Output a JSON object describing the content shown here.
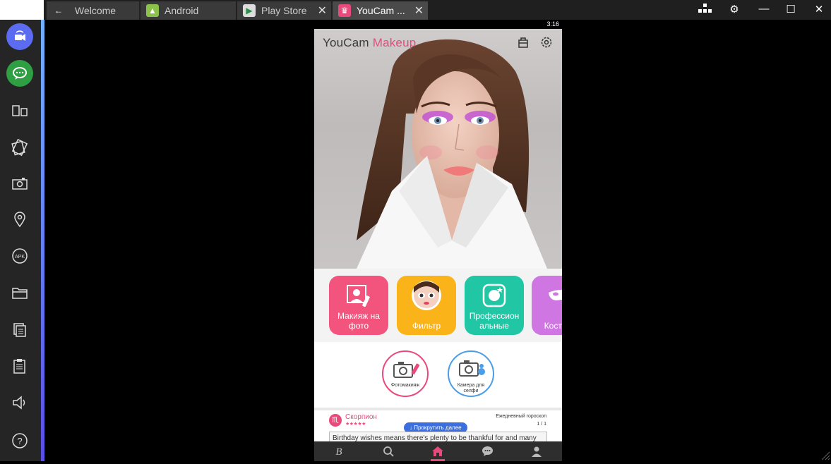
{
  "tabs": [
    {
      "label": "Welcome",
      "icon": "arrow-left-icon"
    },
    {
      "label": "Android",
      "icon": "android-icon"
    },
    {
      "label": "Play Store",
      "icon": "play-store-icon"
    },
    {
      "label": "YouCam ...",
      "icon": "youcam-app-icon"
    }
  ],
  "status": {
    "time": "3:16"
  },
  "app": {
    "logo_part1": "YouCam",
    "logo_part2": "Makeup"
  },
  "features": [
    {
      "label": "Макияж на фото",
      "color": "#f2547d"
    },
    {
      "label": "Фильтр",
      "color": "#fbb31a"
    },
    {
      "label": "Профессион альные",
      "color": "#21c7a4"
    },
    {
      "label": "Кост мак",
      "color": "#cf76e3"
    }
  ],
  "circles": [
    {
      "label": "Фотомакияж",
      "color": "#e94a7b"
    },
    {
      "label": "Камера для селфи",
      "color": "#4a9ee8"
    }
  ],
  "horoscope": {
    "sign": "Скорпион",
    "stars": "★★★★★",
    "daily_label": "Ежедневный гороскоп",
    "page": "1 / 1",
    "scroll_button": "Прокрутить далее",
    "message": "Birthday wishes means there's plenty to be thankful for and many"
  },
  "colors": {
    "accent": "#e94a7b",
    "scroll_button": "#3b6fe0",
    "sidebar_gradient_top": "#6fb3ff",
    "sidebar_gradient_bottom": "#5a4ee8"
  }
}
